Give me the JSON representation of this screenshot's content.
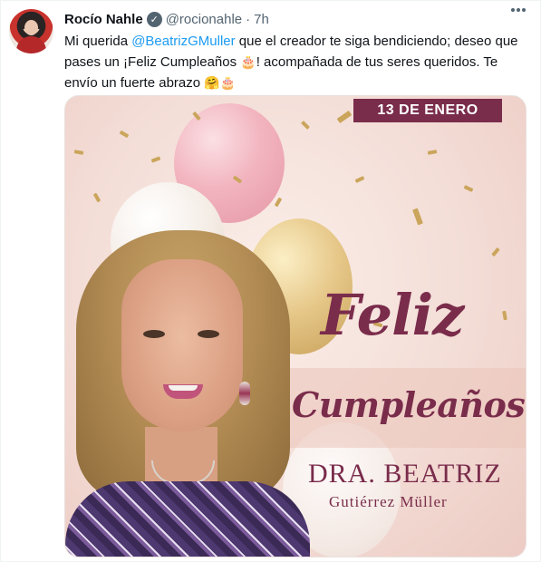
{
  "tweet": {
    "display_name": "Rocío Nahle",
    "verified_glyph": "✓",
    "handle": "@rocionahle",
    "separator": "·",
    "time": "7h",
    "text": {
      "part1": "Mi querida ",
      "mention": "@BeatrizGMuller",
      "part2": " que el creador te siga bendiciendo; deseo que pases un ¡Feliz Cumpleaños ",
      "emoji_cake_1": "🎂",
      "part3": "! acompañada de tus seres queridos. Te envío un fuerte abrazo ",
      "emoji_hug": "🤗",
      "emoji_cake_2": "🎂"
    }
  },
  "media": {
    "date": "13 DE ENERO",
    "line1": "Feliz",
    "line2": "Cumpleaños",
    "line3": "DRA. BEATRIZ",
    "line4": "Gutiérrez Müller"
  },
  "colors": {
    "brand_text": "#7a2c4b",
    "mention": "#1d9bf0",
    "secondary": "#536471"
  },
  "icons": [
    "verified-badge-icon",
    "more-options-icon"
  ]
}
